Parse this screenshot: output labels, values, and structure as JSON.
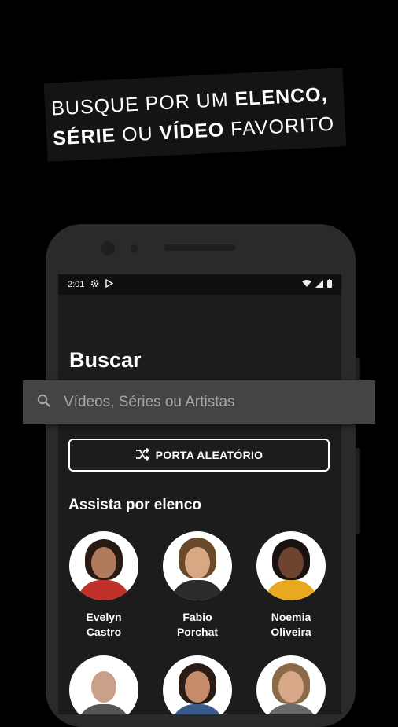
{
  "headline": {
    "line1_normal": "BUSQUE POR UM ",
    "line1_bold": "ELENCO,",
    "line2_bold1": "SÉRIE",
    "line2_normal1": " OU ",
    "line2_bold2": "VÍDEO",
    "line2_normal2": " FAVORITO"
  },
  "status": {
    "time": "2:01"
  },
  "page": {
    "title": "Buscar"
  },
  "search": {
    "placeholder": "Vídeos, Séries ou Artistas"
  },
  "random": {
    "label": "PORTA ALEATÓRIO"
  },
  "cast_section": {
    "title": "Assista por elenco",
    "members": [
      {
        "first": "Evelyn",
        "last": "Castro"
      },
      {
        "first": "Fabio",
        "last": "Porchat"
      },
      {
        "first": "Noemia",
        "last": "Oliveira"
      }
    ]
  }
}
